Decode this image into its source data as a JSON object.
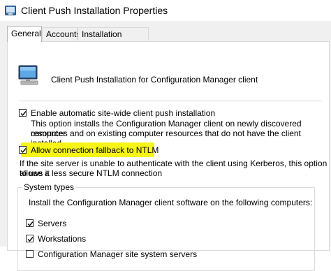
{
  "window": {
    "title": "Client Push Installation Properties",
    "icon": "sccm-app-icon"
  },
  "tabs": [
    {
      "label": "General",
      "active": true
    },
    {
      "label": "Accounts",
      "active": false
    },
    {
      "label": "Installation Properties",
      "active": false
    }
  ],
  "general": {
    "header_icon": "computer-icon",
    "header_text": "Client Push Installation for Configuration Manager client",
    "enable_push": {
      "label": "Enable automatic site-wide client push installation",
      "checked": true,
      "description_line1": "This option installs the Configuration Manager client on newly discovered computer",
      "description_line2": "resources and on existing computer resources that do not have the client installed."
    },
    "ntlm_fallback": {
      "label": "Allow connection fallback to NTLM",
      "checked": true,
      "highlight_color": "#f7f516",
      "description_line1": "If the site server is unable to authenticate with the client using Kerberos, this option allows it",
      "description_line2": "to use a less secure NTLM connection"
    },
    "system_types": {
      "legend": "System types",
      "intro": "Install the Configuration Manager client software on the following computers:",
      "options": [
        {
          "label": "Servers",
          "checked": true
        },
        {
          "label": "Workstations",
          "checked": true
        },
        {
          "label": "Configuration Manager site system servers",
          "checked": false
        }
      ]
    }
  }
}
